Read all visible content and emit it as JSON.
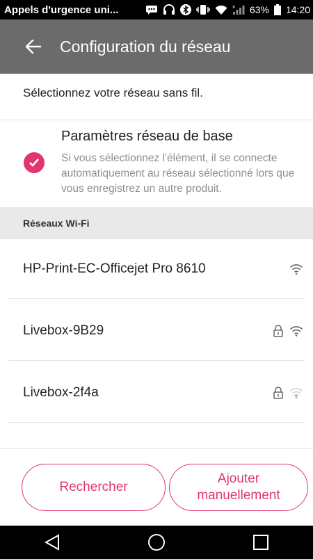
{
  "status_bar": {
    "notification": "Appels d'urgence uni...",
    "battery": "63%",
    "time": "14:20"
  },
  "app_bar": {
    "title": "Configuration du réseau"
  },
  "instruction": "Sélectionnez votre réseau sans fil.",
  "basic_settings": {
    "title": "Paramètres réseau de base",
    "description": "Si vous sélectionnez l'élément, il se connecte automatiquement au réseau sélectionné lors que vous enregistrez un autre produit.",
    "checked": true
  },
  "section_header": "Réseaux Wi-Fi",
  "networks": [
    {
      "name": "HP-Print-EC-Officejet Pro 8610",
      "locked": false,
      "signal": "strong"
    },
    {
      "name": "Livebox-9B29",
      "locked": true,
      "signal": "strong"
    },
    {
      "name": "Livebox-2f4a",
      "locked": true,
      "signal": "weak"
    }
  ],
  "buttons": {
    "search": "Rechercher",
    "add_line1": "Ajouter",
    "add_line2": "manuellement"
  },
  "colors": {
    "accent": "#e2346e",
    "app_bar": "#6b6b6b"
  }
}
